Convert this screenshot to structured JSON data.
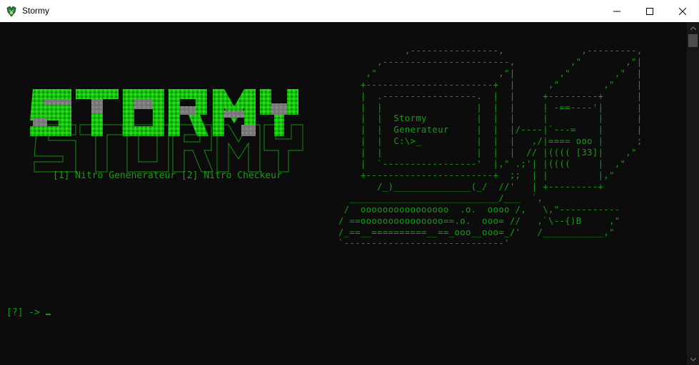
{
  "window": {
    "title": "Stormy",
    "buttons": {
      "minimize": "minimize",
      "maximize": "maximize",
      "close": "close"
    }
  },
  "console": {
    "logo_text": "STORMY",
    "menu_line": "[1] Nitro Genenerateur [2] Nitro Checkeur",
    "computer_art": "            ,----------------,              ,---------,\n       ,-----------------------,          ,\"        ,\"|\n     ,\"                      ,\"|        ,\"        ,\"  |\n    +-----------------------+  |      ,\"        ,\"    |\n    |  .-----------------.  |  |     +---------+      |\n    |  |                 |  |  |     | -==----'|      |\n    |  |  Stormy         |  |  |     |         |      |\n    |  |  Generateur     |  |  |/----|`---=    |      |\n    |  |  C:\\>_          |  |  |   ,/|==== ooo |      ;\n    |  |                 |  |  |  // |(((( [33]|    ,\"\n    |  `-----------------'  |,\" .;'| |((((     |  ,\"\n    +-----------------------+  ;;  | |         |,\"\n       /_)______________(_/  //'   | +---------+\n  ___________________________/___  `,\n /  oooooooooooooooo  .o.  oooo /,   \\,\"-----------\n/ ==ooooooooooooooo==.o.  ooo= //   ,`\\--{)B     ,\"\n/_==__==========__==_ooo__ooo=_/'   /___________,\"\n`-----------------------------'",
    "prompt": "[?] -> "
  },
  "colors": {
    "console_bg": "#0c0c0c",
    "console_text": "#13a10e",
    "logo_green": "#16c60c",
    "logo_gray": "#767676"
  }
}
